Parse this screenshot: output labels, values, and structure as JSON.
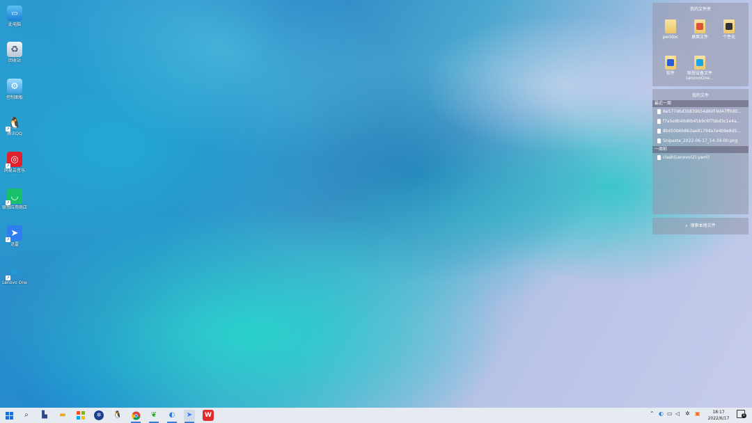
{
  "desktop": {
    "icons": [
      {
        "label": "此电脑",
        "icon": "computer-icon"
      },
      {
        "label": "回收站",
        "icon": "recycle-bin-icon"
      },
      {
        "label": "控制面板",
        "icon": "control-panel-icon"
      },
      {
        "label": "腾讯QQ",
        "icon": "qq-icon"
      },
      {
        "label": "网易云音乐",
        "icon": "netease-music-icon"
      },
      {
        "label": "联想应用商店",
        "icon": "lenovo-store-icon"
      },
      {
        "label": "迅雷",
        "icon": "thunder-icon"
      },
      {
        "label": "Lenovo One",
        "icon": "lenovo-one-icon"
      }
    ]
  },
  "fences": {
    "folders_panel": {
      "title": "我的文件夹",
      "items": [
        {
          "label": "perldoc"
        },
        {
          "label": "桌面文件"
        },
        {
          "label": "个性化"
        },
        {
          "label": "软件"
        },
        {
          "label": "联想设备文件\nLenovoOne..."
        }
      ]
    },
    "recent_panel": {
      "title": "我的文件",
      "sections": [
        {
          "header": "最近一周",
          "files": [
            "8e577d6d3b839b54d60f-9d47ff0d0...",
            "f7a5e8b40d6b45b9c6f7bbd3c1e4a...",
            "8b450b6b8b3ae8179da7e4b9e8d5...",
            "Snipaste_2022-06-17_14-34-00.png"
          ]
        },
        {
          "header": "一周前",
          "files": [
            "clash(Lenovo(2).yaml)"
          ]
        }
      ]
    },
    "bottom_bar": {
      "label": "搜索本地文件"
    }
  },
  "taskbar": {
    "clock": {
      "time": "18:17",
      "date": "2022/6/17"
    },
    "notification_count": "1"
  }
}
